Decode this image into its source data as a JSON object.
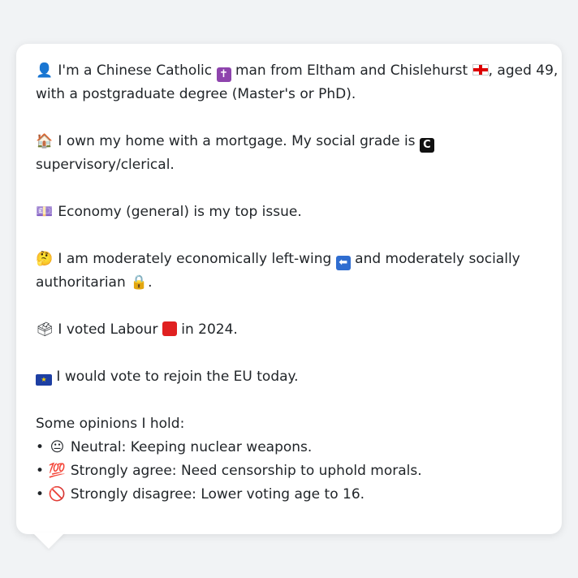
{
  "profile": {
    "p1_l1_pre": "I'm a Chinese Catholic",
    "p1_l1_mid": "man from Eltham and Chislehurst",
    "p1_l1_post": ", aged 49,",
    "p1_l2": "with a postgraduate degree (Master's or PhD).",
    "p2_l1": "I own my home with a mortgage. My social grade is",
    "p2_grade": "C",
    "p2_l2": "supervisory/clerical.",
    "p3": "Economy (general) is my top issue.",
    "p4_l1_pre": "I am moderately economically left-wing",
    "p4_l1_post": "and moderately socially",
    "p4_l2": "authoritarian",
    "p4_l2_end": ".",
    "p5_pre": "I voted Labour",
    "p5_post": "in 2024.",
    "p6": "I would vote to rejoin the EU today."
  },
  "opinions": {
    "heading": "Some opinions I hold:",
    "items": [
      {
        "bullet": "•",
        "emoji": "😐",
        "text": "Neutral: Keeping nuclear weapons."
      },
      {
        "bullet": "•",
        "emoji": "💯",
        "text": "Strongly agree: Need censorship to uphold morals."
      },
      {
        "bullet": "•",
        "emoji": "🚫",
        "text": "Strongly disagree: Lower voting age to 16."
      }
    ]
  },
  "icons": {
    "person": "person-silhouette-icon",
    "cross": "latin-cross-icon",
    "england_flag": "england-flag-icon",
    "house": "house-icon",
    "grade": "letter-c-icon",
    "money": "banknote-icon",
    "thinking": "thinking-face-icon",
    "left_arrow": "left-arrow-icon",
    "lock": "lock-icon",
    "ballot": "ballot-box-icon",
    "red_square": "red-square-icon",
    "eu_flag": "eu-flag-icon"
  },
  "colors": {
    "background": "#f1f3f5",
    "card": "#ffffff",
    "text": "#212529",
    "labour_red": "#e02020"
  }
}
